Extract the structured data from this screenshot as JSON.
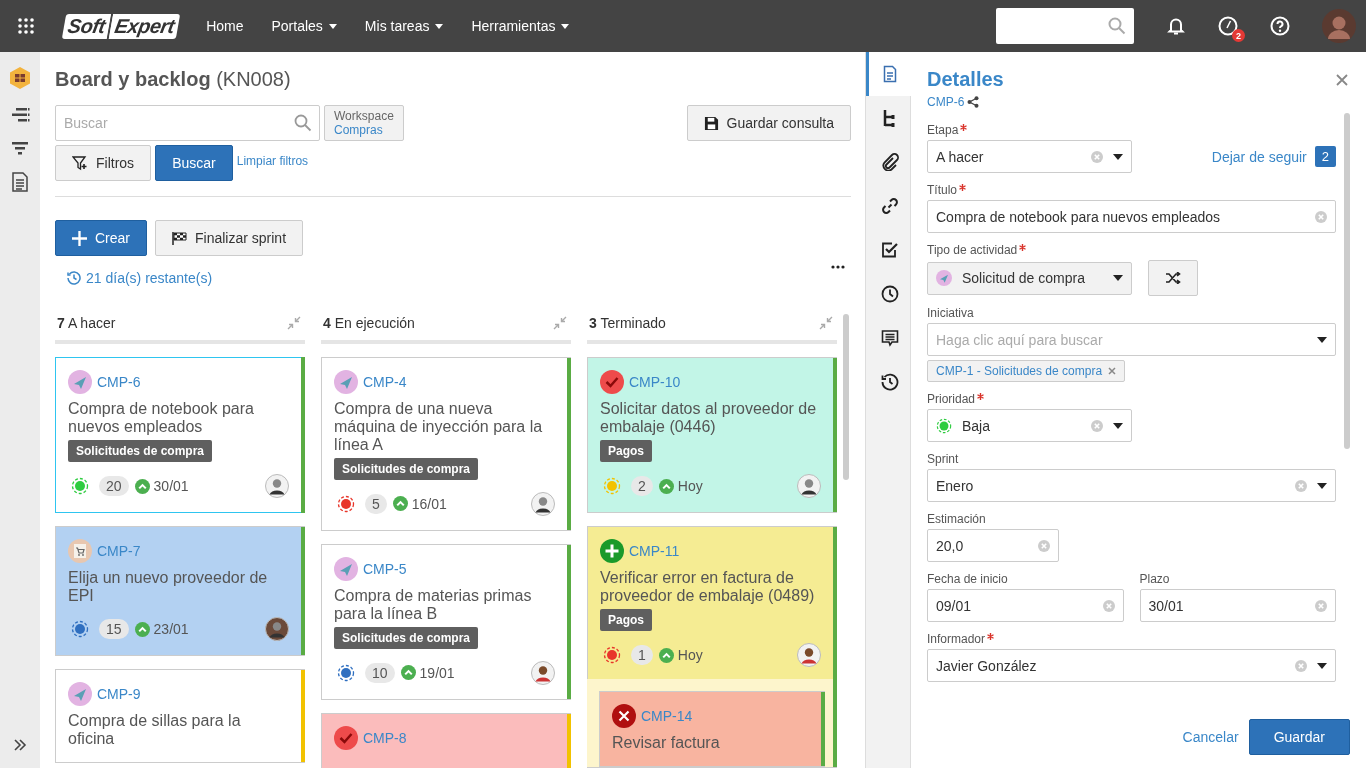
{
  "topbar": {
    "logo_left": "Soft",
    "logo_right": "Expert",
    "menu": [
      {
        "label": "Home",
        "dropdown": false
      },
      {
        "label": "Portales",
        "dropdown": true
      },
      {
        "label": "Mis tareas",
        "dropdown": true
      },
      {
        "label": "Herramientas",
        "dropdown": true
      }
    ],
    "notification_badge": "2"
  },
  "page": {
    "title": "Board y backlog",
    "code": "(KN008)"
  },
  "search": {
    "placeholder": "Buscar"
  },
  "workspace": {
    "label": "Workspace",
    "value": "Compras"
  },
  "buttons": {
    "save_query": "Guardar consulta",
    "filters": "Filtros",
    "search": "Buscar",
    "clear_filters": "Limpiar filtros",
    "create": "Crear",
    "finish_sprint": "Finalizar sprint"
  },
  "remaining": "21 día(s) restante(s)",
  "columns": [
    {
      "count": "7",
      "title": "A hacer",
      "cards": [
        {
          "id": "CMP-6",
          "kind": "purchase",
          "title": "Compra de notebook para nuevos empleados",
          "tag": "Solicitudes de compra",
          "priority": {
            "color": "#2ecc40"
          },
          "points": "20",
          "date": "30/01",
          "background": {
            "color": "#ffffff"
          },
          "stripe": {
            "color": "#5aac44"
          },
          "selected": true,
          "avatar": {
            "kind": "man"
          }
        },
        {
          "id": "CMP-7",
          "kind": "cart",
          "title": "Elija un nuevo proveedor de EPI",
          "priority": {
            "color": "#2f6fc0"
          },
          "points": "15",
          "date": "23/01",
          "background": {
            "color": "#b3d1f2"
          },
          "stripe": {
            "color": "#5aac44"
          },
          "selected": false,
          "avatar": {
            "kind": "dark"
          }
        },
        {
          "id": "CMP-9",
          "kind": "purchase",
          "title": "Compra de sillas para la oficina",
          "background": {
            "color": "#ffffff"
          },
          "stripe": {
            "color": "#f2c200"
          },
          "selected": false
        }
      ]
    },
    {
      "count": "4",
      "title": "En ejecución",
      "cards": [
        {
          "id": "CMP-4",
          "kind": "purchase",
          "title": "Compra de una nueva máquina de inyección para la línea A",
          "tag": "Solicitudes de compra",
          "priority": {
            "color": "#e8352a"
          },
          "points": "5",
          "date": "16/01",
          "background": {
            "color": "#ffffff"
          },
          "stripe": {
            "color": "#5aac44"
          },
          "selected": false,
          "avatar": {
            "kind": "man"
          }
        },
        {
          "id": "CMP-5",
          "kind": "purchase",
          "title": "Compra de materias primas para la línea B",
          "tag": "Solicitudes de compra",
          "priority": {
            "color": "#2f6fc0"
          },
          "points": "10",
          "date": "19/01",
          "background": {
            "color": "#ffffff"
          },
          "stripe": {
            "color": "#5aac44"
          },
          "selected": false,
          "avatar": {
            "kind": "woman"
          }
        },
        {
          "id": "CMP-8",
          "kind": "check",
          "background": {
            "color": "#fbbcbc"
          },
          "stripe": {
            "color": "#f2c200"
          },
          "selected": false
        }
      ]
    },
    {
      "count": "3",
      "title": "Terminado",
      "cards": [
        {
          "id": "CMP-10",
          "kind": "check",
          "title": "Solicitar datos al proveedor de embalaje (0446)",
          "tag": "Pagos",
          "priority": {
            "color": "#f2c200"
          },
          "points": "2",
          "date": "Hoy",
          "background": {
            "color": "#c2f5e7"
          },
          "stripe": {
            "color": "#5aac44"
          },
          "selected": false,
          "avatar": {
            "kind": "man"
          }
        },
        {
          "id": "CMP-11",
          "kind": "plus",
          "title": "Verificar error en factura de proveedor de embalaje (0489)",
          "tag": "Pagos",
          "priority": {
            "color": "#e8352a"
          },
          "points": "1",
          "date": "Hoy",
          "background": {
            "color": "#f5ec93"
          },
          "stripe": {
            "color": "#5aac44"
          },
          "selected": false,
          "avatar": {
            "kind": "woman"
          },
          "children": [
            {
              "id": "CMP-14",
              "kind": "cross",
              "title": "Revisar factura",
              "background": {
                "color": "#f8b4a0"
              },
              "stripe": {
                "color": "#5aac44"
              },
              "selected": false
            }
          ]
        }
      ]
    }
  ],
  "details": {
    "tabs": [
      {
        "kind": "document",
        "selected": true
      },
      {
        "kind": "tree",
        "selected": false
      },
      {
        "kind": "attachment",
        "selected": false
      },
      {
        "kind": "link",
        "selected": false
      },
      {
        "kind": "checklist",
        "selected": false
      },
      {
        "kind": "clock",
        "selected": false
      },
      {
        "kind": "comment",
        "selected": false
      },
      {
        "kind": "history",
        "selected": false
      }
    ],
    "title": "Detalles",
    "ref": "CMP-6",
    "follow": "Dejar de seguir",
    "followers": "2",
    "stage": {
      "label": "Etapa",
      "required": true,
      "value": "A hacer"
    },
    "name": {
      "label": "Título",
      "required": true,
      "value": "Compra de notebook para nuevos empleados"
    },
    "activity_type": {
      "label": "Tipo de actividad",
      "required": true,
      "value": "Solicitud de compra"
    },
    "initiative": {
      "label": "Iniciativa",
      "placeholder": "Haga clic aquí para buscar",
      "chip": "CMP-1 - Solicitudes de compra"
    },
    "priority": {
      "label": "Prioridad",
      "required": true,
      "value": "Baja",
      "color": "#2ecc40"
    },
    "sprint": {
      "label": "Sprint",
      "value": "Enero"
    },
    "estimate": {
      "label": "Estimación",
      "value": "20,0"
    },
    "start_date": {
      "label": "Fecha de inicio",
      "value": "09/01"
    },
    "deadline": {
      "label": "Plazo",
      "value": "30/01"
    },
    "reporter": {
      "label": "Informador",
      "required": true,
      "value": "Javier González"
    },
    "cancel": "Cancelar",
    "save": "Guardar"
  }
}
